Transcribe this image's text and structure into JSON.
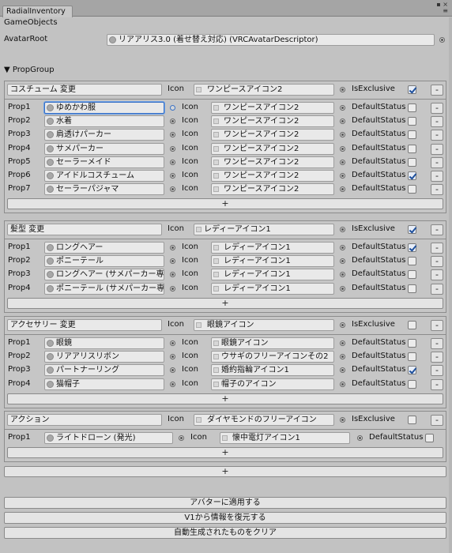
{
  "window": {
    "tab_title": "RadialInventory"
  },
  "section_title": "GameObjects",
  "avatar_root": {
    "label": "AvatarRoot",
    "value": "リアアリス3.0 (着せ替え対応) (VRCAvatarDescriptor)"
  },
  "prop_group_label": "PropGroup",
  "col_labels": {
    "icon": "Icon",
    "is_exclusive": "IsExclusive",
    "default_status": "DefaultStatus"
  },
  "groups": [
    {
      "name": "コスチューム 変更",
      "icon": "ワンピースアイコン2",
      "is_exclusive": true,
      "props": [
        {
          "label": "Prop1",
          "object": "ゆめかわ服",
          "icon": "ワンピースアイコン2",
          "default": false
        },
        {
          "label": "Prop2",
          "object": "水着",
          "icon": "ワンピースアイコン2",
          "default": false
        },
        {
          "label": "Prop3",
          "object": "肩透けパーカー",
          "icon": "ワンピースアイコン2",
          "default": false
        },
        {
          "label": "Prop4",
          "object": "サメパーカー",
          "icon": "ワンピースアイコン2",
          "default": false
        },
        {
          "label": "Prop5",
          "object": "セーラーメイド",
          "icon": "ワンピースアイコン2",
          "default": false
        },
        {
          "label": "Prop6",
          "object": "アイドルコスチューム",
          "icon": "ワンピースアイコン2",
          "default": true
        },
        {
          "label": "Prop7",
          "object": "セーラーパジャマ",
          "icon": "ワンピースアイコン2",
          "default": false
        }
      ]
    },
    {
      "name": "髪型 変更",
      "icon": "レディーアイコン1",
      "is_exclusive": true,
      "props": [
        {
          "label": "Prop1",
          "object": "ロングヘアー",
          "icon": "レディーアイコン1",
          "default": true
        },
        {
          "label": "Prop2",
          "object": "ポニーテール",
          "icon": "レディーアイコン1",
          "default": false
        },
        {
          "label": "Prop3",
          "object": "ロングヘアー (サメパーカー専用)",
          "icon": "レディーアイコン1",
          "default": false
        },
        {
          "label": "Prop4",
          "object": "ポニーテール (サメパーカー専用)",
          "icon": "レディーアイコン1",
          "default": false
        }
      ]
    },
    {
      "name": "アクセサリー 変更",
      "icon": "眼鏡アイコン",
      "is_exclusive": false,
      "props": [
        {
          "label": "Prop1",
          "object": "眼鏡",
          "icon": "眼鏡アイコン",
          "default": false
        },
        {
          "label": "Prop2",
          "object": "リアアリスリボン",
          "icon": "ウサギのフリーアイコンその2",
          "default": false
        },
        {
          "label": "Prop3",
          "object": "パートナーリング",
          "icon": "婚約指輪アイコン1",
          "default": true
        },
        {
          "label": "Prop4",
          "object": "猫帽子",
          "icon": "帽子のアイコン",
          "default": false
        }
      ]
    },
    {
      "name": "アクション",
      "icon": "ダイヤモンドのフリーアイコン",
      "is_exclusive": false,
      "props": [
        {
          "label": "Prop1",
          "object": "ライトドローン (発光)",
          "icon": "懐中電灯アイコン1",
          "default": false
        }
      ]
    }
  ],
  "buttons": {
    "plus": "+",
    "minus": "-",
    "apply": "アバターに適用する",
    "restore": "V1から情報を復元する",
    "clear": "自動生成されたものをクリア"
  }
}
